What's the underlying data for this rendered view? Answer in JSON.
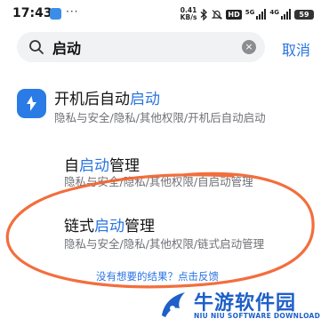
{
  "status_bar": {
    "time": "17:43",
    "more": "···",
    "net_speed_value": "0.41",
    "net_speed_unit": "KB/s",
    "hd_label": "HD",
    "sim1_label": "5G",
    "sim2_label": "4G",
    "battery": "59",
    "icons": [
      "app-notification-icon",
      "bluetooth-icon",
      "mute-icon",
      "signal-icon",
      "battery-icon"
    ]
  },
  "search": {
    "query": "启动",
    "cancel_label": "取消"
  },
  "results": [
    {
      "title_prefix": "开机后自动",
      "title_highlight": "启动",
      "title_suffix": "",
      "path": "隐私与安全/隐私/其他权限/开机后自动启动",
      "icon": "autostart-app-icon"
    },
    {
      "title_prefix": "自",
      "title_highlight": "启动",
      "title_suffix": "管理",
      "path": "隐私与安全/隐私/其他权限/自启动管理"
    },
    {
      "title_prefix": "链式",
      "title_highlight": "启动",
      "title_suffix": "管理",
      "path": "隐私与安全/隐私/其他权限/链式启动管理"
    }
  ],
  "footer": {
    "no_result_text": "没有想要的结果？点击反馈"
  },
  "watermark": {
    "title": "牛游软件园",
    "subtitle": "NIU NIU SOFTWARE DOWNLOAD"
  },
  "colors": {
    "accent": "#2a74e2",
    "annotation": "#f2622d",
    "watermark": "#1e5fc8"
  }
}
